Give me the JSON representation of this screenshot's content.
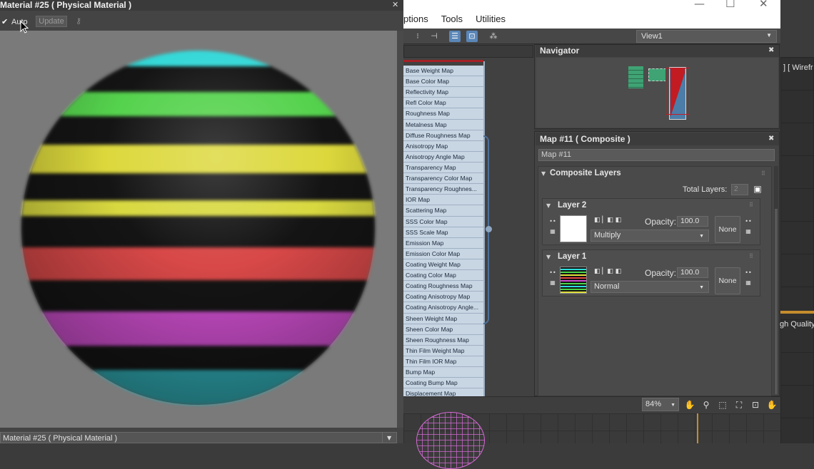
{
  "material_window": {
    "title": "Material #25  ( Physical Material )",
    "auto_check": "✔",
    "auto_label": "Auto",
    "update_label": "Update",
    "footer_selection": "Material #25  ( Physical Material )"
  },
  "slate": {
    "menu": [
      "ptions",
      "Tools",
      "Utilities"
    ],
    "window_controls": {
      "minimize": "—",
      "maximize": "☐",
      "close": "✕"
    },
    "view_dropdown": "View1",
    "map_list": [
      "Base Weight Map",
      "Base Color Map",
      "Reflectivity Map",
      "Refl Color Map",
      "Roughness Map",
      "Metalness Map",
      "Diffuse Roughness Map",
      "Anisotropy Map",
      "Anisotropy Angle Map",
      "Transparency Map",
      "Transparency Color Map",
      "Transparency Roughnes...",
      "IOR Map",
      "Scattering Map",
      "SSS Color Map",
      "SSS Scale Map",
      "Emission Map",
      "Emission Color Map",
      "Coating Weight Map",
      "Coating Color Map",
      "Coating Roughness Map",
      "Coating Anisotropy Map",
      "Coating Anisotropy Angle...",
      "Sheen Weight Map",
      "Sheen Color Map",
      "Sheen Roughness Map",
      "Thin Film Weight Map",
      "Thin Film IOR Map",
      "Bump Map",
      "Coating Bump Map",
      "Displacement Map"
    ],
    "navigator": {
      "title": "Navigator"
    },
    "map_panel": {
      "title": "Map #11  ( Composite )",
      "name_field": "Map #11",
      "rollout_title": "Composite Layers",
      "total_layers_label": "Total Layers:",
      "total_layers_value": "2",
      "layers": [
        {
          "title": "Layer 2",
          "opacity_label": "Opacity:",
          "opacity": "100.0",
          "blend_mode": "Multiply",
          "mask": "None"
        },
        {
          "title": "Layer 1",
          "opacity_label": "Opacity:",
          "opacity": "100.0",
          "blend_mode": "Normal",
          "mask": "None"
        }
      ]
    },
    "zoom": "84%"
  },
  "viewport": {
    "label": "] [ Wirefr",
    "quality_label": "gh Quality"
  },
  "colors": {
    "sphere_stripes": [
      "#36d8d8",
      "#55d24d",
      "#dcd83c",
      "#d84848",
      "#c84cc8",
      "#2ea6ae"
    ],
    "list_bg": "#c8d5e3",
    "accent_blue": "#5a86b8"
  }
}
